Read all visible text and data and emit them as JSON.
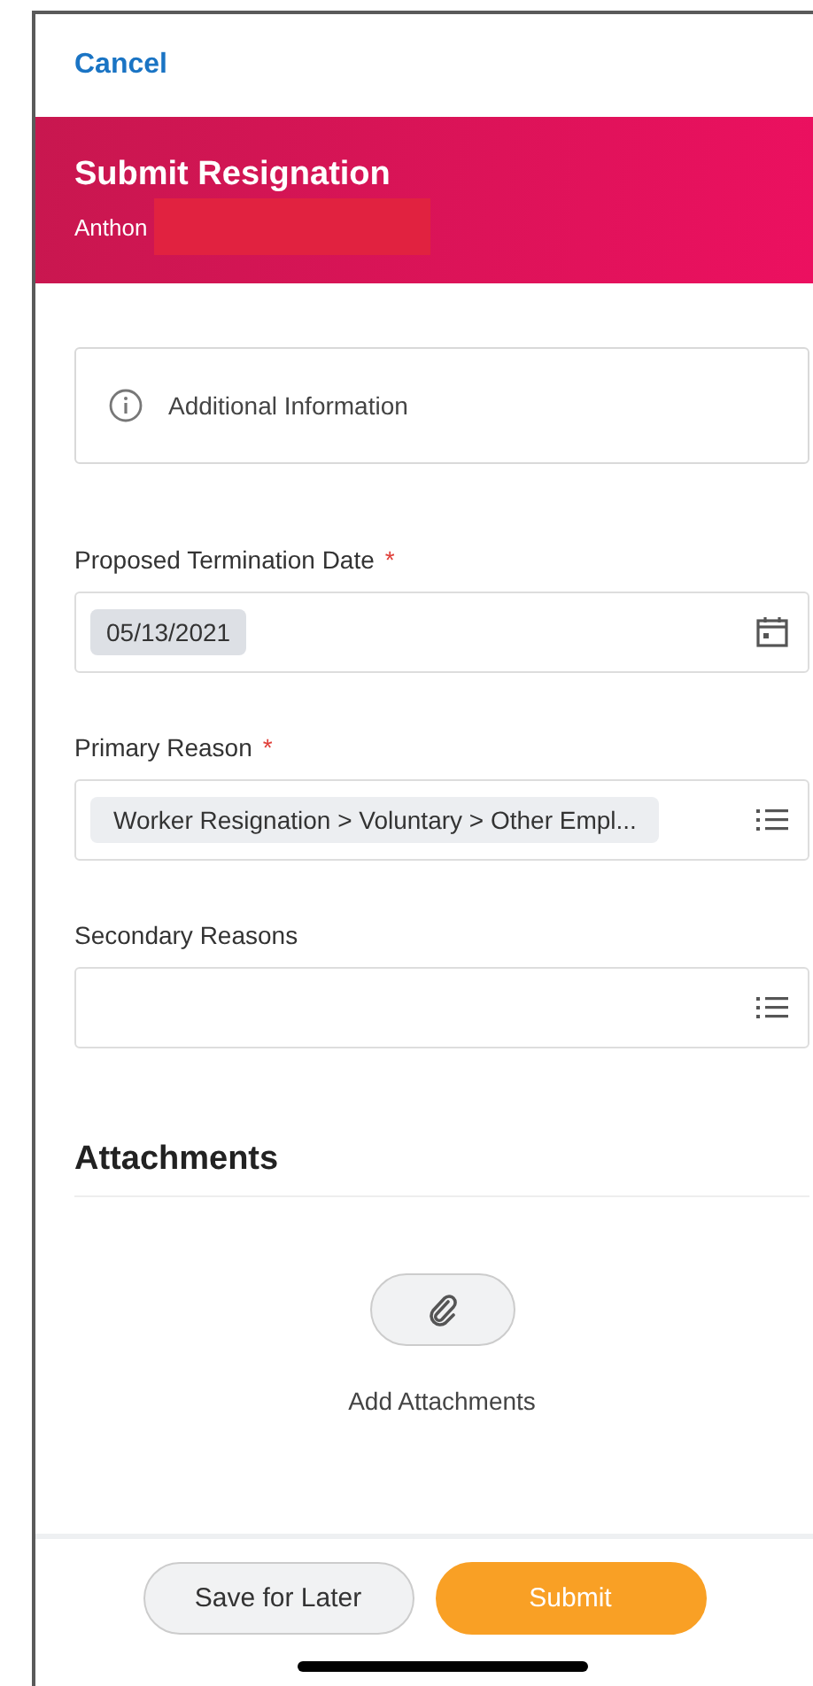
{
  "nav": {
    "cancel": "Cancel"
  },
  "header": {
    "title": "Submit Resignation",
    "subtitle": "Anthon",
    "redacted": true
  },
  "info": {
    "label": "Additional Information"
  },
  "fields": [
    {
      "kind": "date",
      "label": "Proposed Termination Date",
      "required_mark": "*",
      "value": "05/13/2021"
    },
    {
      "kind": "list",
      "label": "Primary Reason",
      "required_mark": "*",
      "value": "Worker Resignation > Voluntary > Other Empl..."
    },
    {
      "kind": "list",
      "label": "Secondary Reasons"
    }
  ],
  "attachments": {
    "heading": "Attachments",
    "action": "Add Attachments"
  },
  "footer": {
    "buttons": [
      {
        "label": "Save for Later",
        "kind": "secondary"
      },
      {
        "label": "Submit",
        "kind": "primary"
      }
    ]
  }
}
